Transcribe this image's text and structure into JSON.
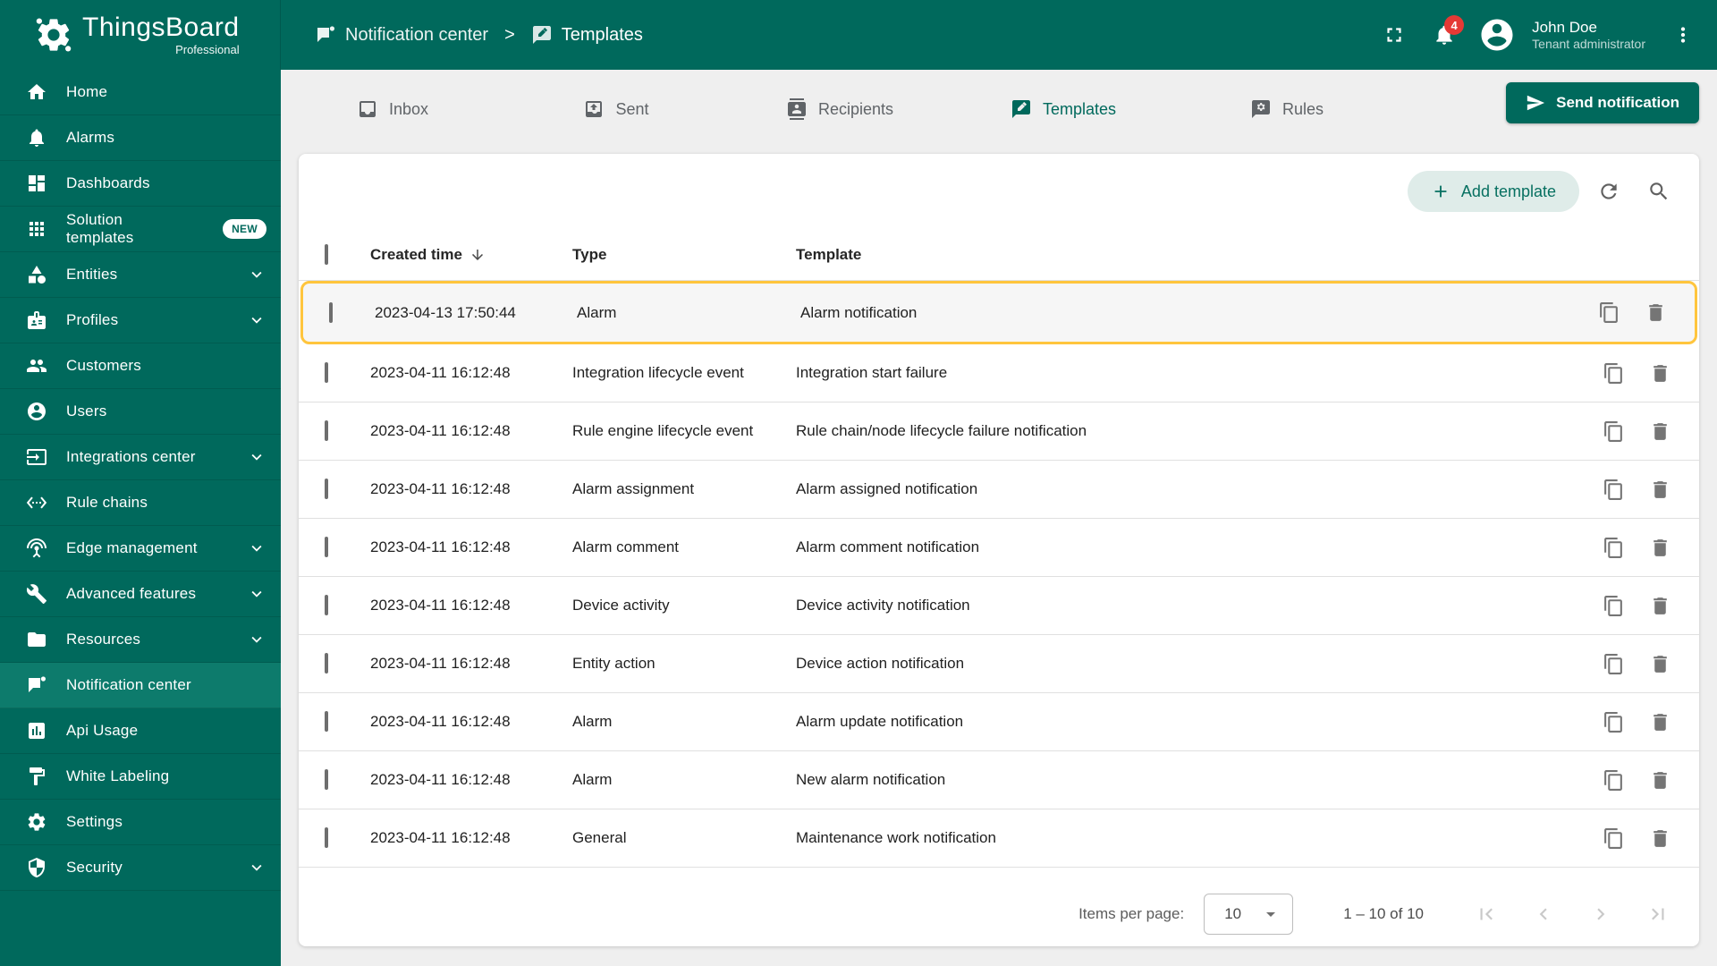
{
  "colors": {
    "teal": "#00695C",
    "teal_active": "#0D7B6C",
    "accent": "#00695C",
    "highlight_border": "#FFC53D",
    "badge_red": "#E53935"
  },
  "app": {
    "brand": "ThingsBoard",
    "brand_sub": "Professional"
  },
  "topbar": {
    "breadcrumb": [
      {
        "label": "Notification center",
        "icon": "notification-center"
      },
      {
        "label": "Templates",
        "icon": "templates"
      }
    ],
    "notifications_badge": "4",
    "user": {
      "name": "John Doe",
      "role": "Tenant administrator"
    }
  },
  "sidebar": {
    "items": [
      {
        "label": "Home",
        "icon": "home"
      },
      {
        "label": "Alarms",
        "icon": "alarm-bell"
      },
      {
        "label": "Dashboards",
        "icon": "dashboards"
      },
      {
        "label": "Solution templates",
        "icon": "solution-templates",
        "badge": "NEW"
      },
      {
        "label": "Entities",
        "icon": "entities",
        "expandable": true
      },
      {
        "label": "Profiles",
        "icon": "profiles",
        "expandable": true
      },
      {
        "label": "Customers",
        "icon": "customers"
      },
      {
        "label": "Users",
        "icon": "users"
      },
      {
        "label": "Integrations center",
        "icon": "integrations",
        "expandable": true
      },
      {
        "label": "Rule chains",
        "icon": "rule-chains"
      },
      {
        "label": "Edge management",
        "icon": "edge-management",
        "expandable": true
      },
      {
        "label": "Advanced features",
        "icon": "advanced-features",
        "expandable": true
      },
      {
        "label": "Resources",
        "icon": "resources",
        "expandable": true
      },
      {
        "label": "Notification center",
        "icon": "notification-center",
        "active": true
      },
      {
        "label": "Api Usage",
        "icon": "api-usage"
      },
      {
        "label": "White Labeling",
        "icon": "white-labeling"
      },
      {
        "label": "Settings",
        "icon": "settings"
      },
      {
        "label": "Security",
        "icon": "security",
        "expandable": true
      }
    ]
  },
  "tabs": [
    {
      "label": "Inbox",
      "icon": "inbox"
    },
    {
      "label": "Sent",
      "icon": "sent"
    },
    {
      "label": "Recipients",
      "icon": "recipients"
    },
    {
      "label": "Templates",
      "icon": "templates",
      "active": true
    },
    {
      "label": "Rules",
      "icon": "rules"
    }
  ],
  "actions": {
    "send_notification": "Send notification",
    "add_template": "Add template"
  },
  "table": {
    "columns": {
      "created": "Created time",
      "type": "Type",
      "template": "Template"
    },
    "rows": [
      {
        "created": "2023-04-13 17:50:44",
        "type": "Alarm",
        "template": "Alarm notification",
        "highlighted": true
      },
      {
        "created": "2023-04-11 16:12:48",
        "type": "Integration lifecycle event",
        "template": "Integration start failure"
      },
      {
        "created": "2023-04-11 16:12:48",
        "type": "Rule engine lifecycle event",
        "template": "Rule chain/node lifecycle failure notification"
      },
      {
        "created": "2023-04-11 16:12:48",
        "type": "Alarm assignment",
        "template": "Alarm assigned notification"
      },
      {
        "created": "2023-04-11 16:12:48",
        "type": "Alarm comment",
        "template": "Alarm comment notification"
      },
      {
        "created": "2023-04-11 16:12:48",
        "type": "Device activity",
        "template": "Device activity notification"
      },
      {
        "created": "2023-04-11 16:12:48",
        "type": "Entity action",
        "template": "Device action notification"
      },
      {
        "created": "2023-04-11 16:12:48",
        "type": "Alarm",
        "template": "Alarm update notification"
      },
      {
        "created": "2023-04-11 16:12:48",
        "type": "Alarm",
        "template": "New alarm notification"
      },
      {
        "created": "2023-04-11 16:12:48",
        "type": "General",
        "template": "Maintenance work notification"
      }
    ]
  },
  "pagination": {
    "items_per_page_label": "Items per page:",
    "page_size": "10",
    "range": "1 – 10 of 10"
  }
}
